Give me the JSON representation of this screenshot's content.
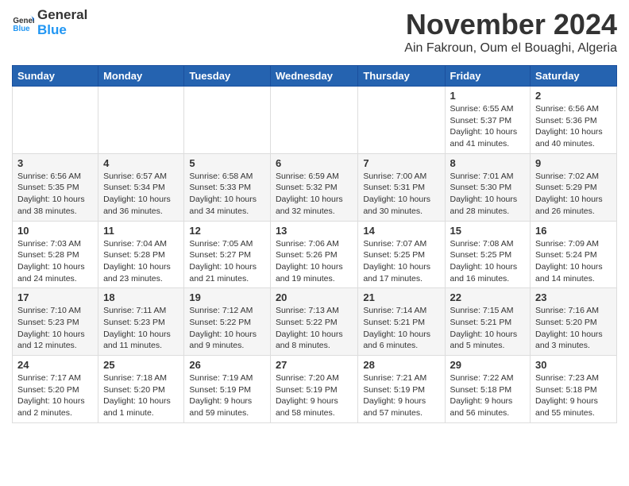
{
  "logo": {
    "line1": "General",
    "line2": "Blue"
  },
  "title": "November 2024",
  "subtitle": "Ain Fakroun, Oum el Bouaghi, Algeria",
  "headers": [
    "Sunday",
    "Monday",
    "Tuesday",
    "Wednesday",
    "Thursday",
    "Friday",
    "Saturday"
  ],
  "weeks": [
    [
      {
        "day": "",
        "info": ""
      },
      {
        "day": "",
        "info": ""
      },
      {
        "day": "",
        "info": ""
      },
      {
        "day": "",
        "info": ""
      },
      {
        "day": "",
        "info": ""
      },
      {
        "day": "1",
        "info": "Sunrise: 6:55 AM\nSunset: 5:37 PM\nDaylight: 10 hours and 41 minutes."
      },
      {
        "day": "2",
        "info": "Sunrise: 6:56 AM\nSunset: 5:36 PM\nDaylight: 10 hours and 40 minutes."
      }
    ],
    [
      {
        "day": "3",
        "info": "Sunrise: 6:56 AM\nSunset: 5:35 PM\nDaylight: 10 hours and 38 minutes."
      },
      {
        "day": "4",
        "info": "Sunrise: 6:57 AM\nSunset: 5:34 PM\nDaylight: 10 hours and 36 minutes."
      },
      {
        "day": "5",
        "info": "Sunrise: 6:58 AM\nSunset: 5:33 PM\nDaylight: 10 hours and 34 minutes."
      },
      {
        "day": "6",
        "info": "Sunrise: 6:59 AM\nSunset: 5:32 PM\nDaylight: 10 hours and 32 minutes."
      },
      {
        "day": "7",
        "info": "Sunrise: 7:00 AM\nSunset: 5:31 PM\nDaylight: 10 hours and 30 minutes."
      },
      {
        "day": "8",
        "info": "Sunrise: 7:01 AM\nSunset: 5:30 PM\nDaylight: 10 hours and 28 minutes."
      },
      {
        "day": "9",
        "info": "Sunrise: 7:02 AM\nSunset: 5:29 PM\nDaylight: 10 hours and 26 minutes."
      }
    ],
    [
      {
        "day": "10",
        "info": "Sunrise: 7:03 AM\nSunset: 5:28 PM\nDaylight: 10 hours and 24 minutes."
      },
      {
        "day": "11",
        "info": "Sunrise: 7:04 AM\nSunset: 5:28 PM\nDaylight: 10 hours and 23 minutes."
      },
      {
        "day": "12",
        "info": "Sunrise: 7:05 AM\nSunset: 5:27 PM\nDaylight: 10 hours and 21 minutes."
      },
      {
        "day": "13",
        "info": "Sunrise: 7:06 AM\nSunset: 5:26 PM\nDaylight: 10 hours and 19 minutes."
      },
      {
        "day": "14",
        "info": "Sunrise: 7:07 AM\nSunset: 5:25 PM\nDaylight: 10 hours and 17 minutes."
      },
      {
        "day": "15",
        "info": "Sunrise: 7:08 AM\nSunset: 5:25 PM\nDaylight: 10 hours and 16 minutes."
      },
      {
        "day": "16",
        "info": "Sunrise: 7:09 AM\nSunset: 5:24 PM\nDaylight: 10 hours and 14 minutes."
      }
    ],
    [
      {
        "day": "17",
        "info": "Sunrise: 7:10 AM\nSunset: 5:23 PM\nDaylight: 10 hours and 12 minutes."
      },
      {
        "day": "18",
        "info": "Sunrise: 7:11 AM\nSunset: 5:23 PM\nDaylight: 10 hours and 11 minutes."
      },
      {
        "day": "19",
        "info": "Sunrise: 7:12 AM\nSunset: 5:22 PM\nDaylight: 10 hours and 9 minutes."
      },
      {
        "day": "20",
        "info": "Sunrise: 7:13 AM\nSunset: 5:22 PM\nDaylight: 10 hours and 8 minutes."
      },
      {
        "day": "21",
        "info": "Sunrise: 7:14 AM\nSunset: 5:21 PM\nDaylight: 10 hours and 6 minutes."
      },
      {
        "day": "22",
        "info": "Sunrise: 7:15 AM\nSunset: 5:21 PM\nDaylight: 10 hours and 5 minutes."
      },
      {
        "day": "23",
        "info": "Sunrise: 7:16 AM\nSunset: 5:20 PM\nDaylight: 10 hours and 3 minutes."
      }
    ],
    [
      {
        "day": "24",
        "info": "Sunrise: 7:17 AM\nSunset: 5:20 PM\nDaylight: 10 hours and 2 minutes."
      },
      {
        "day": "25",
        "info": "Sunrise: 7:18 AM\nSunset: 5:20 PM\nDaylight: 10 hours and 1 minute."
      },
      {
        "day": "26",
        "info": "Sunrise: 7:19 AM\nSunset: 5:19 PM\nDaylight: 9 hours and 59 minutes."
      },
      {
        "day": "27",
        "info": "Sunrise: 7:20 AM\nSunset: 5:19 PM\nDaylight: 9 hours and 58 minutes."
      },
      {
        "day": "28",
        "info": "Sunrise: 7:21 AM\nSunset: 5:19 PM\nDaylight: 9 hours and 57 minutes."
      },
      {
        "day": "29",
        "info": "Sunrise: 7:22 AM\nSunset: 5:18 PM\nDaylight: 9 hours and 56 minutes."
      },
      {
        "day": "30",
        "info": "Sunrise: 7:23 AM\nSunset: 5:18 PM\nDaylight: 9 hours and 55 minutes."
      }
    ]
  ]
}
